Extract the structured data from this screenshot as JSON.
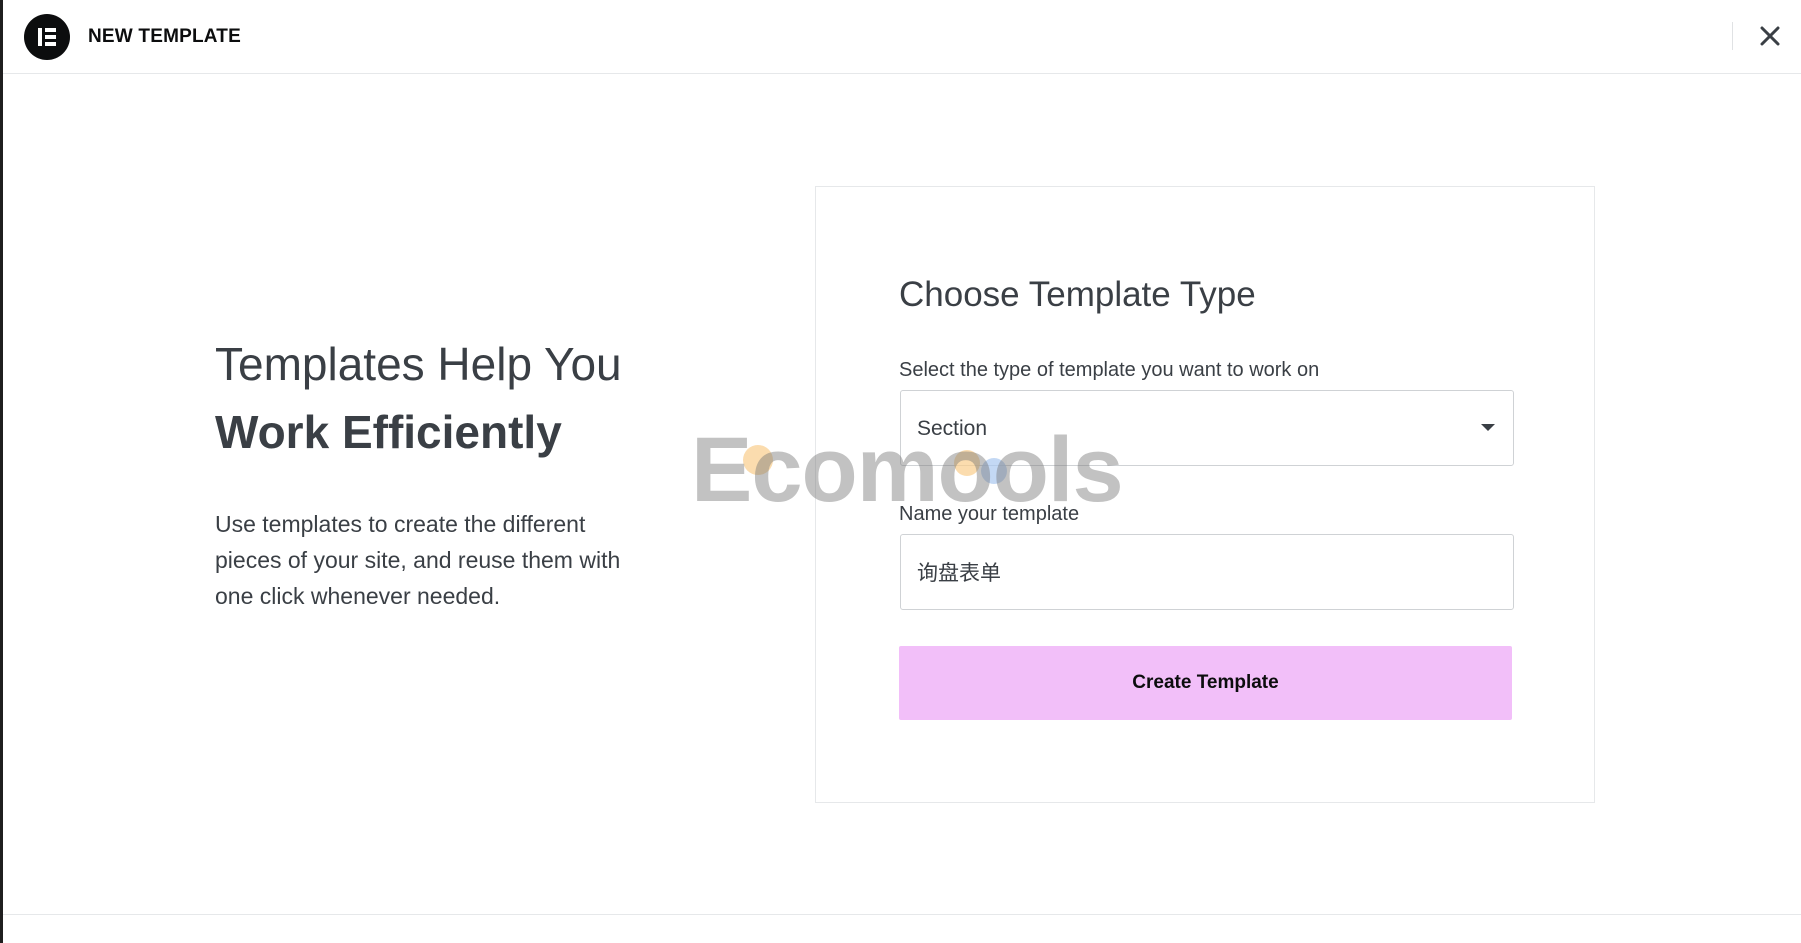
{
  "header": {
    "title": "NEW TEMPLATE",
    "logo_icon": "elementor-logo-icon",
    "close_icon": "close-icon"
  },
  "intro": {
    "heading_line1": "Templates Help You",
    "heading_line2": "Work Efficiently",
    "description": "Use templates to create the different pieces of your site, and reuse them with one click whenever needed."
  },
  "form": {
    "title": "Choose Template Type",
    "type_label": "Select the type of template you want to work on",
    "type_value": "Section",
    "name_label": "Name your template",
    "name_value": "询盘表单",
    "submit_label": "Create Template"
  },
  "watermark": {
    "text": "Ecomools"
  },
  "colors": {
    "button_bg": "#f2bff9",
    "text": "#3a3f45",
    "logo_bg": "#0c0d0e"
  }
}
